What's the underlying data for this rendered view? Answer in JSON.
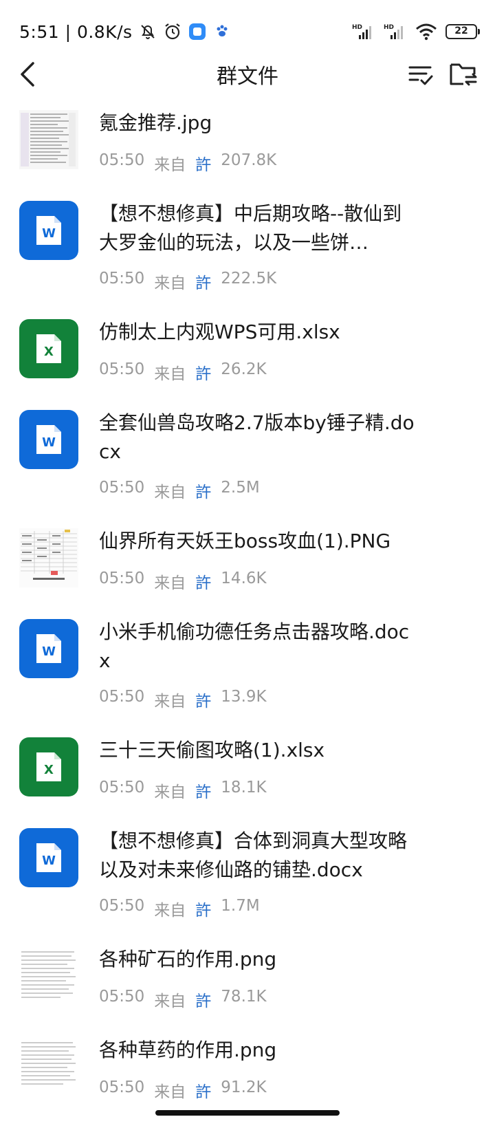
{
  "status_bar": {
    "time_speed": "5:51 | 0.8K/s",
    "battery_level": "22",
    "signal_1_label": "HD",
    "signal_2_label": "HD"
  },
  "header": {
    "title": "群文件"
  },
  "files": [
    {
      "name": "氪金推荐.jpg",
      "time": "05:50",
      "from": "来自",
      "user": "許",
      "size": "207.8K",
      "icon": "image-thumbnail"
    },
    {
      "name": "【想不想修真】中后期攻略--散仙到大罗金仙的玩法，以及一些饼…",
      "time": "05:50",
      "from": "来自",
      "user": "許",
      "size": "222.5K",
      "icon": "word-icon"
    },
    {
      "name": "仿制太上内观WPS可用.xlsx",
      "time": "05:50",
      "from": "来自",
      "user": "許",
      "size": "26.2K",
      "icon": "excel-icon"
    },
    {
      "name": "全套仙兽岛攻略2.7版本by锤子精.docx",
      "time": "05:50",
      "from": "来自",
      "user": "許",
      "size": "2.5M",
      "icon": "word-icon"
    },
    {
      "name": "仙界所有天妖王boss攻血(1).PNG",
      "time": "05:50",
      "from": "来自",
      "user": "許",
      "size": "14.6K",
      "icon": "image-thumbnail"
    },
    {
      "name": "小米手机偷功德任务点击器攻略.docx",
      "time": "05:50",
      "from": "来自",
      "user": "許",
      "size": "13.9K",
      "icon": "word-icon"
    },
    {
      "name": "三十三天偷图攻略(1).xlsx",
      "time": "05:50",
      "from": "来自",
      "user": "許",
      "size": "18.1K",
      "icon": "excel-icon"
    },
    {
      "name": "【想不想修真】合体到洞真大型攻略以及对未来修仙路的铺垫.docx",
      "time": "05:50",
      "from": "来自",
      "user": "許",
      "size": "1.7M",
      "icon": "word-icon"
    },
    {
      "name": "各种矿石的作用.png",
      "time": "05:50",
      "from": "来自",
      "user": "許",
      "size": "78.1K",
      "icon": "image-thumbnail"
    },
    {
      "name": "各种草药的作用.png",
      "time": "05:50",
      "from": "来自",
      "user": "許",
      "size": "91.2K",
      "icon": "image-thumbnail"
    }
  ],
  "colors": {
    "word_blue": "#0f6ad8",
    "excel_green": "#12823a",
    "user_link": "#2a6fc9",
    "meta_gray": "#9a9a9a"
  }
}
